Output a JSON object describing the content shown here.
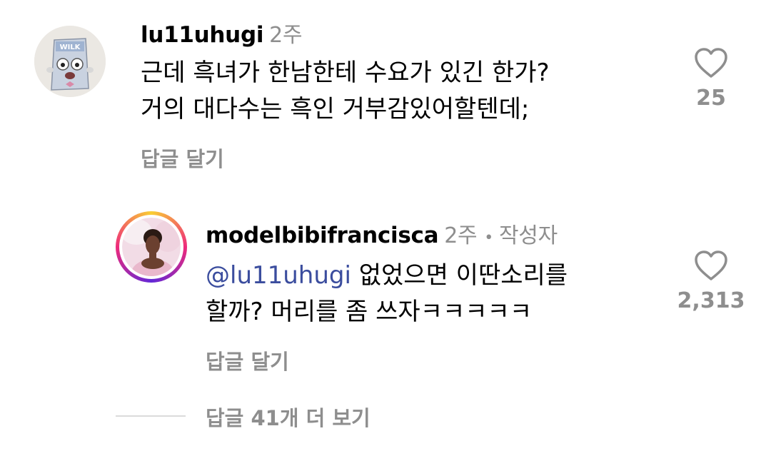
{
  "comment1": {
    "username": "lu11uhugi",
    "time": "2주",
    "line1": "근데 흑녀가 한남한테 수요가 있긴 한가?",
    "line2": "거의 대다수는 흑인 거부감있어할텐데;",
    "reply_label": "답글 달기",
    "likes": "25",
    "avatar_text": "WILK"
  },
  "comment2": {
    "username": "modelbibifrancisca",
    "time": "2주",
    "separator": "•",
    "author_badge": "작성자",
    "mention": "@lu11uhugi",
    "line1_rest": " 없었으면 이딴소리를",
    "line2": "할까? 머리를 좀 쓰자ㅋㅋㅋㅋㅋ",
    "reply_label": "답글 달기",
    "likes": "2,313"
  },
  "view_more": {
    "label": "답글 41개 더 보기"
  },
  "colors": {
    "muted": "#8e8e8e",
    "mention": "#3b4d9e",
    "divider": "#dbdbdb"
  }
}
